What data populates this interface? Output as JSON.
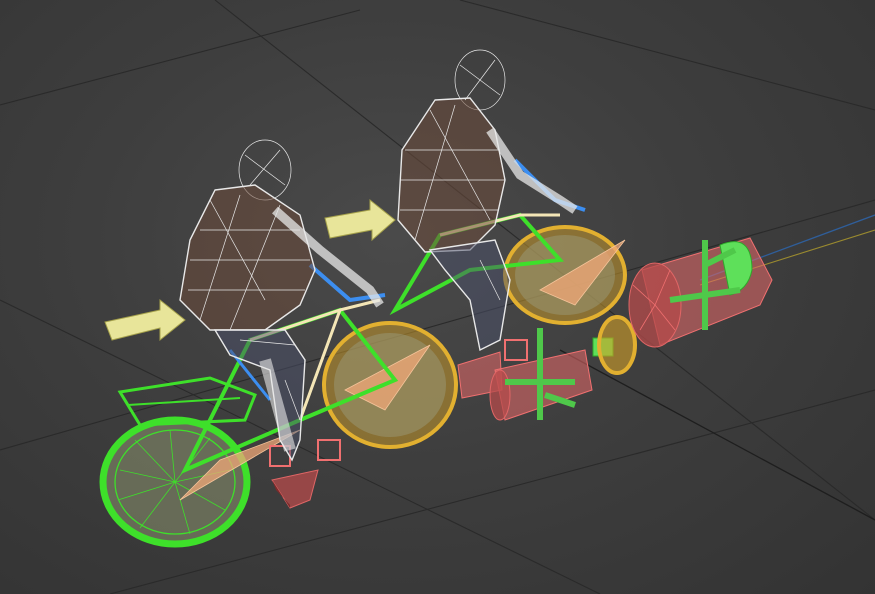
{
  "viewport": {
    "label": "",
    "background_color": "#3b3b3b"
  },
  "colors": {
    "wireframe_human": "#e8e8e8",
    "bike_frame": "#3ee02a",
    "controls_blue": "#3c8ef0",
    "helper_pink": "#e86a6a",
    "gear_gold": "#d2a028",
    "arrow_yellow": "#e8e59a"
  },
  "scene_objects": [
    "human-figure-rear-icon",
    "human-figure-front-icon",
    "rear-bicycle-icon",
    "front-bicycle-icon",
    "direction-arrow-rear-icon",
    "direction-arrow-front-icon",
    "pedal-box-helper-icon",
    "crank-helper-icon",
    "wheel-drum-helper-icon",
    "gear-sprocket-icon"
  ]
}
